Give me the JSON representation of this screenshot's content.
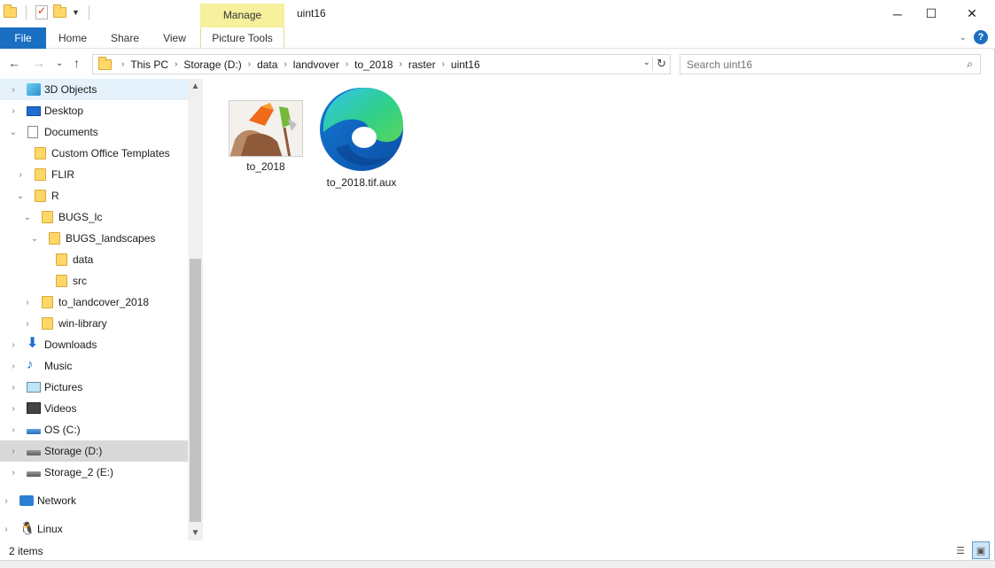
{
  "window": {
    "title": "uint16",
    "manage_tab": "Manage",
    "controls": {
      "minimize": "─",
      "maximize": "☐",
      "close": "✕"
    }
  },
  "ribbon": {
    "file": "File",
    "home": "Home",
    "share": "Share",
    "view": "View",
    "picture_tools": "Picture Tools",
    "help_icon": "?"
  },
  "address": {
    "crumbs": [
      "This PC",
      "Storage (D:)",
      "data",
      "landvover",
      "to_2018",
      "raster",
      "uint16"
    ]
  },
  "search": {
    "placeholder": "Search uint16"
  },
  "nav": {
    "items": [
      {
        "label": "3D Objects",
        "icon": "cube-3d-icon"
      },
      {
        "label": "Desktop",
        "icon": "desktop-icon"
      },
      {
        "label": "Documents",
        "icon": "documents-icon"
      },
      {
        "label": "Custom Office Templates",
        "icon": "folder-icon"
      },
      {
        "label": "FLIR",
        "icon": "folder-icon"
      },
      {
        "label": "R",
        "icon": "folder-icon"
      },
      {
        "label": "BUGS_lc",
        "icon": "folder-icon"
      },
      {
        "label": "BUGS_landscapes",
        "icon": "folder-icon"
      },
      {
        "label": "data",
        "icon": "folder-icon"
      },
      {
        "label": "src",
        "icon": "folder-icon"
      },
      {
        "label": "to_landcover_2018",
        "icon": "folder-icon"
      },
      {
        "label": "win-library",
        "icon": "folder-icon"
      },
      {
        "label": "Downloads",
        "icon": "download-icon"
      },
      {
        "label": "Music",
        "icon": "music-icon"
      },
      {
        "label": "Pictures",
        "icon": "pictures-icon"
      },
      {
        "label": "Videos",
        "icon": "videos-icon"
      },
      {
        "label": "OS (C:)",
        "icon": "os-drive-icon"
      },
      {
        "label": "Storage (D:)",
        "icon": "drive-icon"
      },
      {
        "label": "Storage_2 (E:)",
        "icon": "drive-icon"
      },
      {
        "label": "Network",
        "icon": "network-icon"
      },
      {
        "label": "Linux",
        "icon": "linux-icon"
      }
    ]
  },
  "files": [
    {
      "name": "to_2018",
      "icon": "paint-image-icon"
    },
    {
      "name": "to_2018.tif.aux",
      "icon": "edge-icon"
    }
  ],
  "status": {
    "count": "2 items"
  }
}
